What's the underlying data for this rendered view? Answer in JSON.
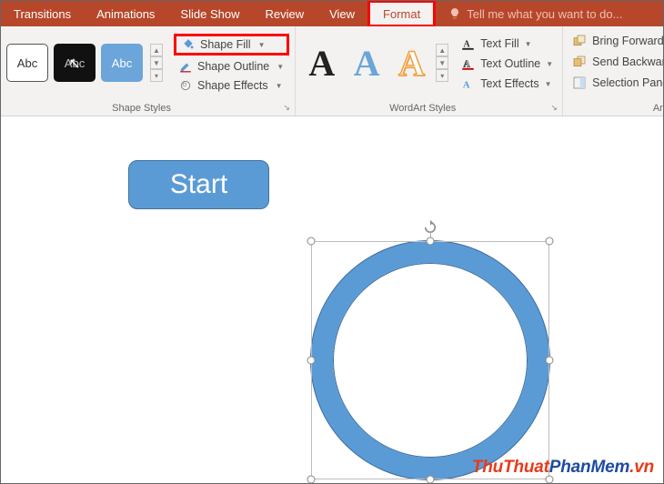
{
  "tabs": {
    "transitions": "Transitions",
    "animations": "Animations",
    "slideshow": "Slide Show",
    "review": "Review",
    "view": "View",
    "format": "Format"
  },
  "tellme": {
    "placeholder": "Tell me what you want to do..."
  },
  "shapeStyles": {
    "label": "Shape Styles",
    "sample": "Abc",
    "fill": "Shape Fill",
    "outline": "Shape Outline",
    "effects": "Shape Effects"
  },
  "wordart": {
    "label": "WordArt Styles",
    "sample": "A",
    "textFill": "Text Fill",
    "textOutline": "Text Outline",
    "textEffects": "Text Effects"
  },
  "arrange": {
    "label": "Arran",
    "forward": "Bring Forward",
    "backward": "Send Backward",
    "selection": "Selection Pane"
  },
  "slide": {
    "startLabel": "Start"
  },
  "watermark": {
    "part1": "ThuThuat",
    "part2": "PhanMem",
    "suffix": ".vn"
  },
  "colors": {
    "accent": "#b7472a",
    "highlight": "#ff0000",
    "shapeFill": "#5b9bd5"
  }
}
